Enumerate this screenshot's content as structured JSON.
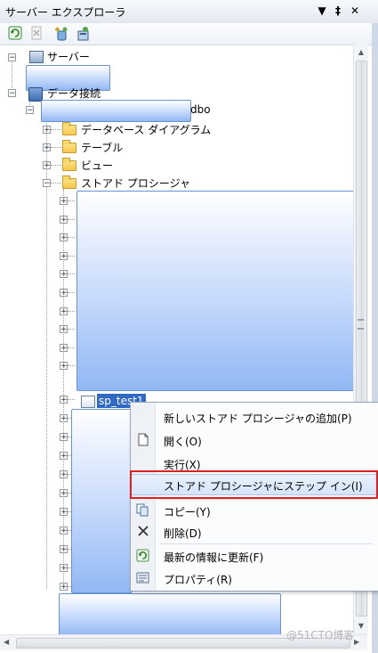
{
  "window": {
    "title": "サーバー エクスプローラ",
    "pin_glyph": "▼",
    "autohide_glyph": "‡",
    "close_glyph": "✕"
  },
  "toolbar": {
    "buttons": [
      {
        "name": "refresh-button",
        "icon": "refresh-icon"
      },
      {
        "name": "stop-refresh-button",
        "icon": "stop-icon"
      },
      {
        "name": "connect-database-button",
        "icon": "connect-db-icon"
      },
      {
        "name": "connect-server-button",
        "icon": "connect-server-icon"
      }
    ]
  },
  "tree": {
    "servers_label": "サーバー",
    "data_connections_label": "データ接続",
    "connection_suffix": "dbo",
    "children": [
      {
        "label": "データベース ダイアグラム"
      },
      {
        "label": "テーブル"
      },
      {
        "label": "ビュー"
      },
      {
        "label": "ストアド プロシージャ"
      }
    ],
    "selected_item": "sp_test1"
  },
  "context_menu": {
    "items": [
      {
        "label": "新しいストアド プロシージャの追加(P)",
        "icon": ""
      },
      {
        "label": "開く(O)",
        "icon": "open-icon"
      },
      {
        "label": "実行(X)",
        "icon": ""
      },
      {
        "label": "ストアド プロシージャにステップ イン(I)",
        "icon": "",
        "highlighted": true
      },
      {
        "label": "コピー(Y)",
        "icon": "copy-icon"
      },
      {
        "label": "削除(D)",
        "icon": "delete-icon"
      },
      {
        "label": "最新の情報に更新(F)",
        "icon": "refresh-icon"
      },
      {
        "label": "プロパティ(R)",
        "icon": "properties-icon"
      }
    ]
  },
  "watermark": "@51CTO博客",
  "colors": {
    "selection": "#316ac5",
    "highlight_box": "#e21f1f",
    "redaction": "#91b8f4"
  }
}
